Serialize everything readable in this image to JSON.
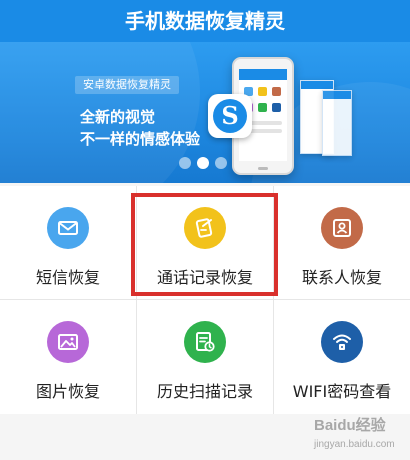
{
  "header": {
    "title": "手机数据恢复精灵"
  },
  "banner": {
    "tag": "安卓数据恢复精灵",
    "line1": "全新的视觉",
    "line2": "不一样的情感体验",
    "badge_letter": "S",
    "dots": 3,
    "active_dot": 1
  },
  "grid": {
    "items": [
      {
        "label": "短信恢复",
        "icon": "envelope-icon",
        "color": "#49a6ee"
      },
      {
        "label": "通话记录恢复",
        "icon": "call-log-icon",
        "color": "#f2c21b"
      },
      {
        "label": "联系人恢复",
        "icon": "contact-card-icon",
        "color": "#c26a48"
      },
      {
        "label": "图片恢复",
        "icon": "picture-icon",
        "color": "#b768d8"
      },
      {
        "label": "历史扫描记录",
        "icon": "scan-history-icon",
        "color": "#2fb24d"
      },
      {
        "label": "WIFI密码查看",
        "icon": "wifi-lock-icon",
        "color": "#1e5fa8"
      }
    ],
    "highlighted_item": "通话记录恢复",
    "highlight_color": "#d9302c"
  },
  "watermark": {
    "text": "Baidu经验",
    "sub": "jingyan.baidu.com"
  },
  "colors": {
    "accent": "#1a8be6"
  }
}
